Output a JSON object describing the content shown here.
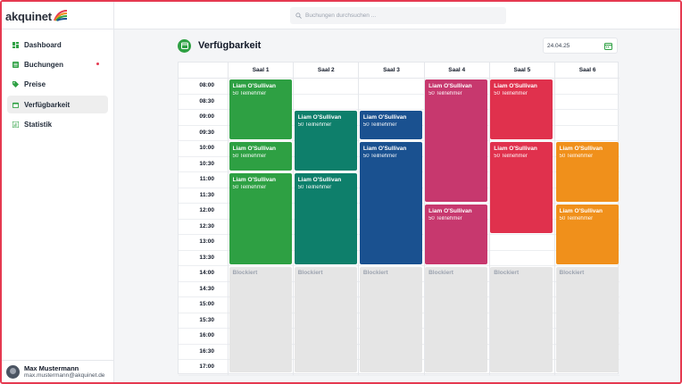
{
  "app": {
    "name": "akquinet"
  },
  "sidebar": {
    "items": [
      {
        "label": "Dashboard",
        "icon": "dashboard-icon",
        "color": "#2ea043"
      },
      {
        "label": "Buchungen",
        "icon": "list-icon",
        "color": "#2ea043",
        "notification": true
      },
      {
        "label": "Preise",
        "icon": "tag-icon",
        "color": "#2ea043"
      },
      {
        "label": "Verfügbarkeit",
        "icon": "calendar-icon",
        "color": "#2ea043",
        "active": true
      },
      {
        "label": "Statistik",
        "icon": "chart-icon",
        "color": "#2ea043"
      }
    ]
  },
  "user": {
    "name": "Max Mustermann",
    "email": "max.mustermann@akquinet.de"
  },
  "search": {
    "placeholder": "Buchungen durchsuchen ..."
  },
  "page": {
    "title": "Verfügbarkeit",
    "date": "24.04.25"
  },
  "calendar": {
    "rooms": [
      "Saal 1",
      "Saal 2",
      "Saal 3",
      "Saal 4",
      "Saal 5",
      "Saal 6"
    ],
    "times": [
      "08:00",
      "08:30",
      "09:00",
      "09:30",
      "10:00",
      "10:30",
      "11:00",
      "11:30",
      "12:00",
      "12:30",
      "13:00",
      "13:30",
      "14:00",
      "14:30",
      "15:00",
      "15:30",
      "16:00",
      "16:30",
      "17:00"
    ],
    "blocked_label": "Blockiert",
    "events": [
      {
        "room": 0,
        "start": "08:00",
        "end": "10:00",
        "name": "Liam O'Sullivan",
        "sub": "50 Teilnehmer",
        "color": "#2ea043"
      },
      {
        "room": 0,
        "start": "10:00",
        "end": "11:00",
        "name": "Liam O'Sullivan",
        "sub": "50 Teilnehmer",
        "color": "#2ea043"
      },
      {
        "room": 0,
        "start": "11:00",
        "end": "14:00",
        "name": "Liam O'Sullivan",
        "sub": "50 Teilnehmer",
        "color": "#2ea043"
      },
      {
        "room": 1,
        "start": "09:00",
        "end": "11:00",
        "name": "Liam O'Sullivan",
        "sub": "50 Teilnehmer",
        "color": "#0e7f6b"
      },
      {
        "room": 1,
        "start": "11:00",
        "end": "14:00",
        "name": "Liam O'Sullivan",
        "sub": "50 Teilnehmer",
        "color": "#0e7f6b"
      },
      {
        "room": 2,
        "start": "09:00",
        "end": "10:00",
        "name": "Liam O'Sullivan",
        "sub": "50 Teilnehmer",
        "color": "#1a5190"
      },
      {
        "room": 2,
        "start": "10:00",
        "end": "14:00",
        "name": "Liam O'Sullivan",
        "sub": "50 Teilnehmer",
        "color": "#1a5190"
      },
      {
        "room": 3,
        "start": "08:00",
        "end": "12:00",
        "name": "Liam O'Sullivan",
        "sub": "50 Teilnehmer",
        "color": "#c7386e"
      },
      {
        "room": 3,
        "start": "12:00",
        "end": "14:00",
        "name": "Liam O'Sullivan",
        "sub": "50 Teilnehmer",
        "color": "#c7386e"
      },
      {
        "room": 4,
        "start": "08:00",
        "end": "10:00",
        "name": "Liam O'Sullivan",
        "sub": "50 Teilnehmer",
        "color": "#e0314d"
      },
      {
        "room": 4,
        "start": "10:00",
        "end": "13:00",
        "name": "Liam O'Sullivan",
        "sub": "50 Teilnehmer",
        "color": "#e0314d"
      },
      {
        "room": 5,
        "start": "10:00",
        "end": "12:00",
        "name": "Liam O'Sullivan",
        "sub": "50 Teilnehmer",
        "color": "#f0901b"
      },
      {
        "room": 5,
        "start": "12:00",
        "end": "14:00",
        "name": "Liam O'Sullivan",
        "sub": "50 Teilnehmer",
        "color": "#f0901b"
      }
    ],
    "blocked_from": "14:00",
    "blocked_to": "17:30"
  },
  "colors": {
    "accent": "#2ea043",
    "frame": "#e53950"
  }
}
